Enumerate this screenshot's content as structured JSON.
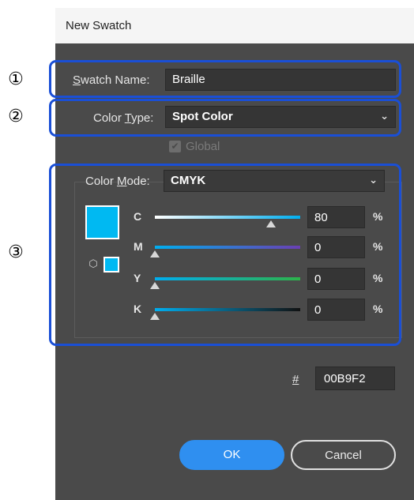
{
  "window": {
    "title": "New Swatch"
  },
  "callouts": [
    "①",
    "②",
    "③"
  ],
  "swatch_name": {
    "label": "Swatch Name:",
    "value": "Braille"
  },
  "color_type": {
    "label": "Color Type:",
    "value": "Spot Color"
  },
  "global": {
    "label": "Global",
    "checked": true,
    "enabled": false
  },
  "color_mode": {
    "label": "Color Mode:",
    "value": "CMYK"
  },
  "channels": [
    {
      "label": "C",
      "value": "80",
      "fraction": 0.8,
      "unit": "%",
      "gradient": [
        "#ffffff",
        "#00aeef"
      ]
    },
    {
      "label": "M",
      "value": "0",
      "fraction": 0.0,
      "unit": "%",
      "gradient": [
        "#00aeef",
        "#6a3fb3"
      ]
    },
    {
      "label": "Y",
      "value": "0",
      "fraction": 0.0,
      "unit": "%",
      "gradient": [
        "#00aeef",
        "#2db34a"
      ]
    },
    {
      "label": "K",
      "value": "0",
      "fraction": 0.0,
      "unit": "%",
      "gradient": [
        "#00aeef",
        "#111111"
      ]
    }
  ],
  "hex": {
    "label": "#",
    "value": "00B9F2"
  },
  "swatch_color": "#00B9F2",
  "buttons": {
    "ok": "OK",
    "cancel": "Cancel"
  },
  "highlight_color": "#1A4FD6"
}
